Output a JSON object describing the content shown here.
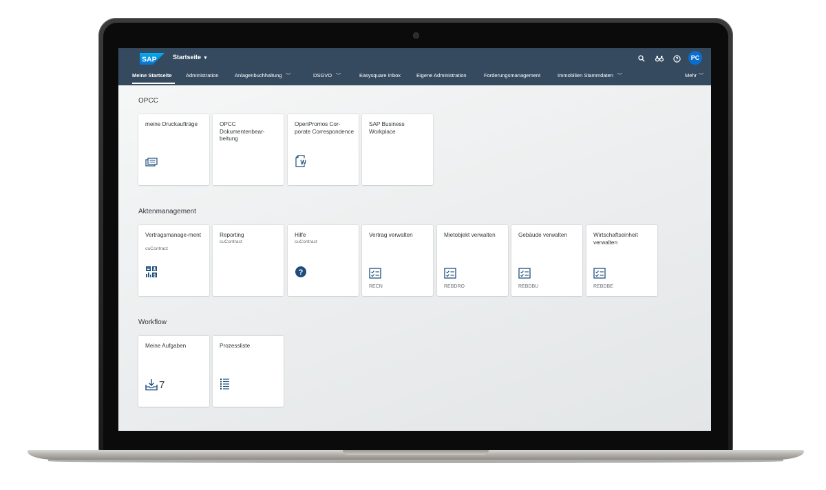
{
  "shell": {
    "logo_text": "SAP",
    "home_title": "Startseite",
    "avatar_initials": "PC",
    "colors": {
      "shellbar": "#354a5f",
      "avatar": "#0a6ed1",
      "icon_blue": "#1d4d7c"
    }
  },
  "tabs": {
    "meine_startseite": "Meine Startseite",
    "administration": "Administration",
    "anlagenbuchhaltung": "Anlagenbuchhaltung",
    "dsgvo": "DSGVO",
    "easysquare_inbox": "Easysquare Inbox",
    "eigene_administration": "Eigene Administration",
    "forderungsmanagement": "Forderungsmanagement",
    "immobilien_stammdaten": "Immobilien Stammdaten",
    "mehr": "Mehr"
  },
  "groups": {
    "opcc": {
      "title": "OPCC",
      "tiles": {
        "t1": {
          "title": "meine Druckaufträge",
          "icon": "print-queue-icon"
        },
        "t2": {
          "title": "OPCC Dokumentenbear-beitung"
        },
        "t3": {
          "title": "OpenPromos Cor-porate Correspondence",
          "icon": "word-document-icon",
          "icon_letter": "W"
        },
        "t4": {
          "title": "SAP Business Workplace"
        }
      }
    },
    "aktenmanagement": {
      "title": "Aktenmanagement",
      "tiles": {
        "t1": {
          "title": "Vertragsmanage-ment",
          "subtitle": "cuContract",
          "icon": "dashboard-icon"
        },
        "t2": {
          "title": "Reporting",
          "subtitle": "cuContract"
        },
        "t3": {
          "title": "Hilfe",
          "subtitle": "cuContract",
          "icon": "help-icon",
          "icon_glyph": "?"
        },
        "t4": {
          "title": "Vertrag verwalten",
          "footer": "RECN",
          "icon": "checklist-icon"
        },
        "t5": {
          "title": "Mietobjekt verwalten",
          "footer": "REBDRO",
          "icon": "checklist-icon"
        },
        "t6": {
          "title": "Gebäude verwalten",
          "footer": "REBDBU",
          "icon": "checklist-icon"
        },
        "t7": {
          "title": "Wirtschaftseinheit verwalten",
          "footer": "REBDBE",
          "icon": "checklist-icon"
        }
      }
    },
    "workflow": {
      "title": "Workflow",
      "tiles": {
        "t1": {
          "title": "Meine Aufgaben",
          "kpi": "7",
          "icon": "inbox-download-icon"
        },
        "t2": {
          "title": "Prozessliste",
          "icon": "list-icon"
        }
      }
    }
  }
}
